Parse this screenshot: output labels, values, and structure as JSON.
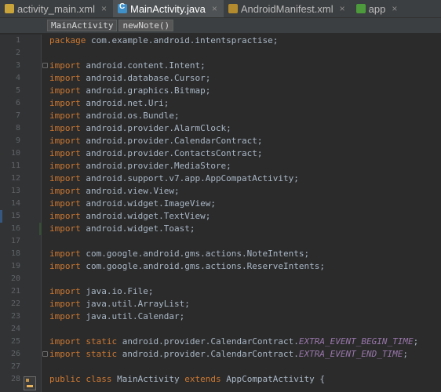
{
  "tabs": [
    {
      "label": "activity_main.xml",
      "icon": "xml-file-icon",
      "active": false,
      "closable": true
    },
    {
      "label": "MainActivity.java",
      "icon": "java-class-icon",
      "active": true,
      "closable": true
    },
    {
      "label": "AndroidManifest.xml",
      "icon": "manifest-file-icon",
      "active": false,
      "closable": true
    },
    {
      "label": "app",
      "icon": "app-module-icon",
      "active": false,
      "closable": true
    }
  ],
  "close_glyph": "×",
  "breadcrumbs": [
    "MainActivity",
    "newNote()"
  ],
  "line_numbers": [
    "1",
    "2",
    "3",
    "4",
    "5",
    "6",
    "7",
    "8",
    "9",
    "10",
    "11",
    "12",
    "13",
    "14",
    "15",
    "16",
    "17",
    "18",
    "19",
    "20",
    "21",
    "22",
    "23",
    "24",
    "25",
    "26",
    "27",
    "28"
  ],
  "code": {
    "l1": {
      "kw": "package",
      "rest": " com.example.android.intentspractise;"
    },
    "imports": [
      "android.content.Intent;",
      "android.database.Cursor;",
      "android.graphics.Bitmap;",
      "android.net.Uri;",
      "android.os.Bundle;",
      "android.provider.AlarmClock;",
      "android.provider.CalendarContract;",
      "android.provider.ContactsContract;",
      "android.provider.MediaStore;",
      "android.support.v7.app.AppCompatActivity;",
      "android.view.View;",
      "android.widget.ImageView;",
      "android.widget.TextView;",
      "android.widget.Toast;",
      "com.google.android.gms.actions.NoteIntents;",
      "com.google.android.gms.actions.ReserveIntents;",
      "java.io.File;",
      "java.util.ArrayList;",
      "java.util.Calendar;"
    ],
    "import_kw": "import",
    "static_kw": "static",
    "static_imports": [
      {
        "path": " android.provider.CalendarContract.",
        "member": "EXTRA_EVENT_BEGIN_TIME",
        "end": ";"
      },
      {
        "path": " android.provider.CalendarContract.",
        "member": "EXTRA_EVENT_END_TIME",
        "end": ";"
      }
    ],
    "l28": {
      "kw1": "public",
      "kw2": "class",
      "name": " MainActivity ",
      "kw3": "extends",
      "rest": " AppCompatActivity {"
    }
  },
  "colors": {
    "keyword": "#cc7832",
    "text": "#a9b7c6",
    "static_field": "#9876aa",
    "background": "#2b2b2b",
    "gutter": "#313335"
  }
}
